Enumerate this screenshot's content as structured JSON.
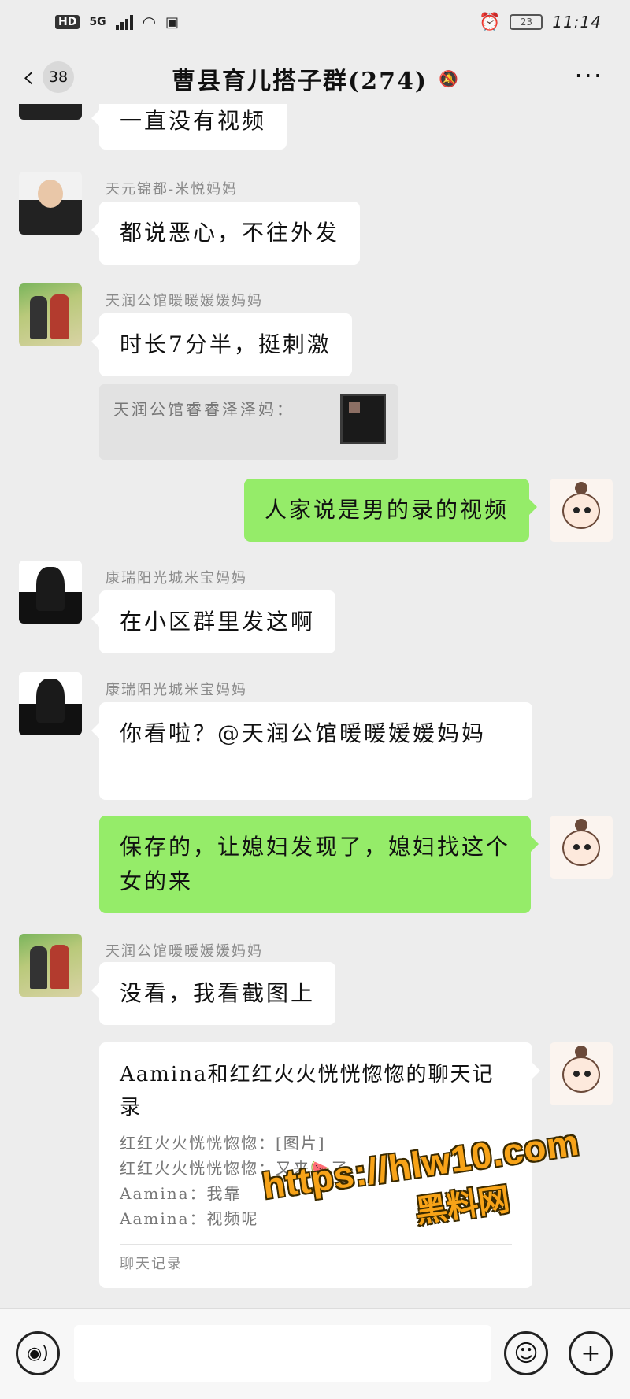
{
  "status": {
    "hd": "HD",
    "network": "5G",
    "battery": "23",
    "time": "11:14"
  },
  "header": {
    "unread_count": "38",
    "title": "曹县育儿搭子群(274)"
  },
  "messages": [
    {
      "text": "一直没有视频"
    },
    {
      "sender": "天元锦都-米悦妈妈",
      "text": "都说恶心，不往外发"
    },
    {
      "sender": "天润公馆暖暖媛媛妈妈",
      "text": "时长7分半，挺刺激"
    },
    {
      "quote": "天润公馆睿睿泽泽妈："
    },
    {
      "text": "人家说是男的录的视频"
    },
    {
      "sender": "康瑞阳光城米宝妈妈",
      "text": "在小区群里发这啊"
    },
    {
      "sender": "康瑞阳光城米宝妈妈",
      "text": "你看啦？@天润公馆暖暖媛媛妈妈"
    },
    {
      "text": "保存的，让媳妇发现了，媳妇找这个女的来"
    },
    {
      "sender": "天润公馆暖暖媛媛妈妈",
      "text": "没看，我看截图上"
    }
  ],
  "chat_record": {
    "title": "Aamina和红红火火恍恍惚惚的聊天记录",
    "lines": [
      "红红火火恍恍惚惚：[图片]",
      "红红火火恍恍惚惚：又来🍉了",
      "Aamina：我靠",
      "Aamina：视频呢"
    ],
    "footer": "聊天记录"
  },
  "watermark": {
    "url": "https://hlw10.com",
    "name": "黑料网"
  },
  "input": {
    "voice_icon": "voice-icon",
    "emoji_icon": "emoji-icon",
    "plus_icon": "plus-icon"
  }
}
